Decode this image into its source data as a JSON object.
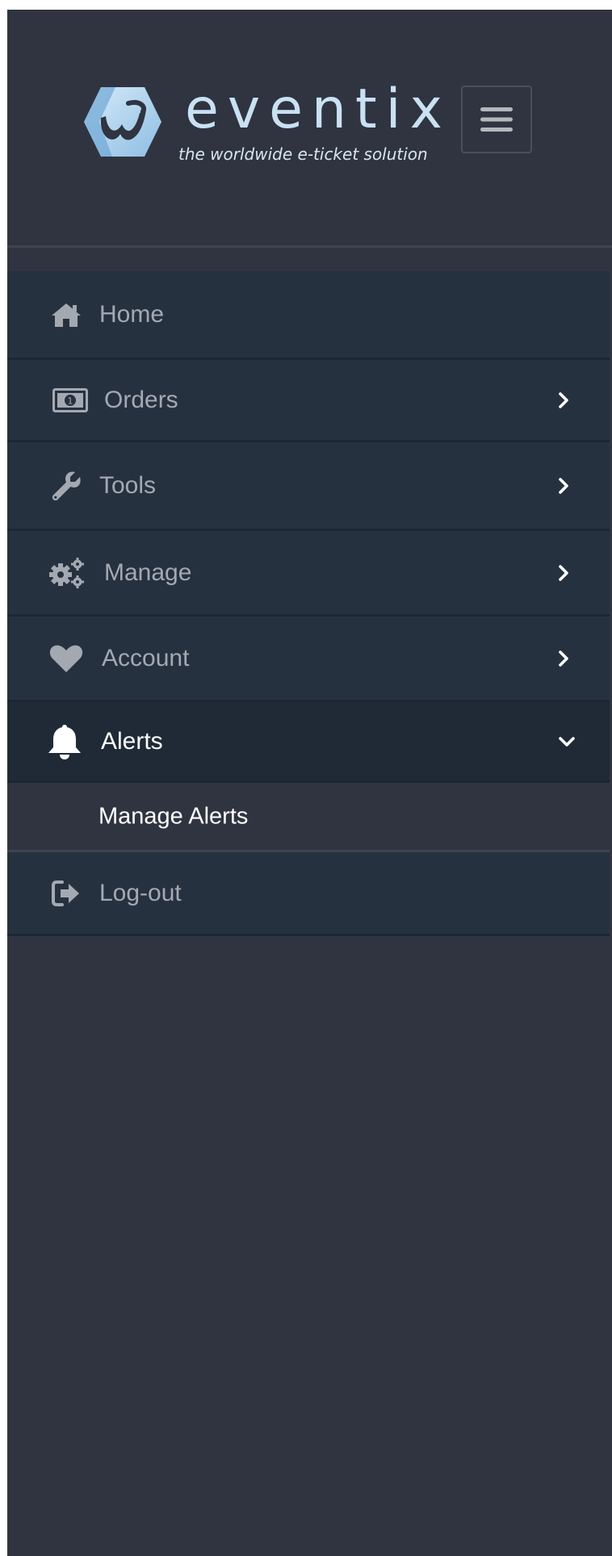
{
  "brand": {
    "name": "eventix",
    "tagline": "the worldwide e-ticket solution",
    "logo_icon": "eventix-logo-icon",
    "colors": {
      "wordmark": "#c9e1f3",
      "mark_light": "#cfe5f6",
      "mark_dark": "#7fb0d9"
    }
  },
  "header": {
    "menu_toggle_icon": "hamburger-menu-icon"
  },
  "nav": {
    "items": [
      {
        "key": "home",
        "label": "Home",
        "icon": "home-icon",
        "expandable": false
      },
      {
        "key": "orders",
        "label": "Orders",
        "icon": "money-bill-icon",
        "expandable": true
      },
      {
        "key": "tools",
        "label": "Tools",
        "icon": "wrench-icon",
        "expandable": true
      },
      {
        "key": "manage",
        "label": "Manage",
        "icon": "gears-icon",
        "expandable": true
      },
      {
        "key": "account",
        "label": "Account",
        "icon": "heart-icon",
        "expandable": true
      },
      {
        "key": "alerts",
        "label": "Alerts",
        "icon": "bell-icon",
        "expandable": true,
        "expanded": true,
        "children": [
          {
            "label": "Manage Alerts"
          }
        ]
      },
      {
        "key": "logout",
        "label": "Log-out",
        "icon": "sign-out-icon",
        "expandable": false
      }
    ]
  },
  "colors": {
    "sidebar_bg": "#2f3440",
    "nav_item_bg": "#263140",
    "nav_item_active_bg": "#202a37",
    "label_muted": "#a4a9b1",
    "label_active": "#ffffff"
  }
}
